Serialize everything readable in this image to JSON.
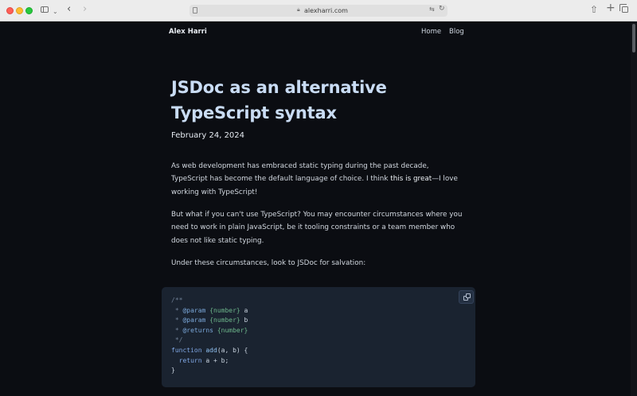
{
  "browser": {
    "url": "alexharri.com",
    "colors": {
      "close": "#ff5f57",
      "minimize": "#febc2e",
      "maximize": "#28c840"
    }
  },
  "site": {
    "name": "Alex Harri",
    "nav": [
      "Home",
      "Blog"
    ]
  },
  "post": {
    "title": "JSDoc as an alternative TypeScript syntax",
    "date": "February 24, 2024",
    "paragraphs": [
      "As web development has embraced static typing during the past decade, TypeScript has become the default language of choice. I think this is great—I love working with TypeScript!",
      "But what if you can't use TypeScript? You may encounter circumstances where you need to work in plain JavaScript, be it tooling constraints or a team member who does not like static typing.",
      "Under these circumstances, look to JSDoc for salvation:"
    ],
    "code": {
      "lines": [
        "/**",
        " * @param {number} a",
        " * @param {number} b",
        " * @returns {number}",
        " */",
        "function add(a, b) {",
        "  return a + b;",
        "}"
      ]
    }
  },
  "colors": {
    "background": "#0b0d12",
    "title": "#c9dcf4",
    "code_background": "#1a2330"
  }
}
